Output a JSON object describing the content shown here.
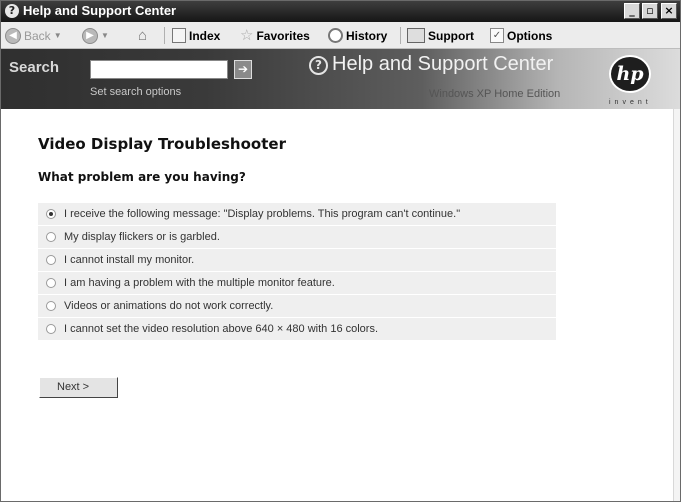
{
  "window": {
    "title": "Help and Support Center",
    "controls": {
      "minimize": "_",
      "maximize": "▫",
      "close": "×"
    }
  },
  "toolbar": {
    "back": "Back",
    "home_icon": "home-icon",
    "index": "Index",
    "favorites": "Favorites",
    "history": "History",
    "support": "Support",
    "options": "Options"
  },
  "banner": {
    "search_label": "Search",
    "search_value": "",
    "search_options": "Set search options",
    "title": "Help and Support Center",
    "edition": "Windows XP Home Edition",
    "logo_text": "hp",
    "logo_tagline": "invent"
  },
  "content": {
    "title": "Video Display Troubleshooter",
    "question": "What problem are you having?",
    "options": [
      {
        "label": "I receive the following message: \"Display problems. This program can't continue.\"",
        "selected": true
      },
      {
        "label": "My display flickers or is garbled.",
        "selected": false
      },
      {
        "label": "I cannot install my monitor.",
        "selected": false
      },
      {
        "label": "I am having a problem with the multiple monitor feature.",
        "selected": false
      },
      {
        "label": "Videos or animations do not work correctly.",
        "selected": false
      },
      {
        "label": "I cannot set the video resolution above 640 × 480 with 16 colors.",
        "selected": false
      }
    ],
    "next_button": "Next >"
  }
}
